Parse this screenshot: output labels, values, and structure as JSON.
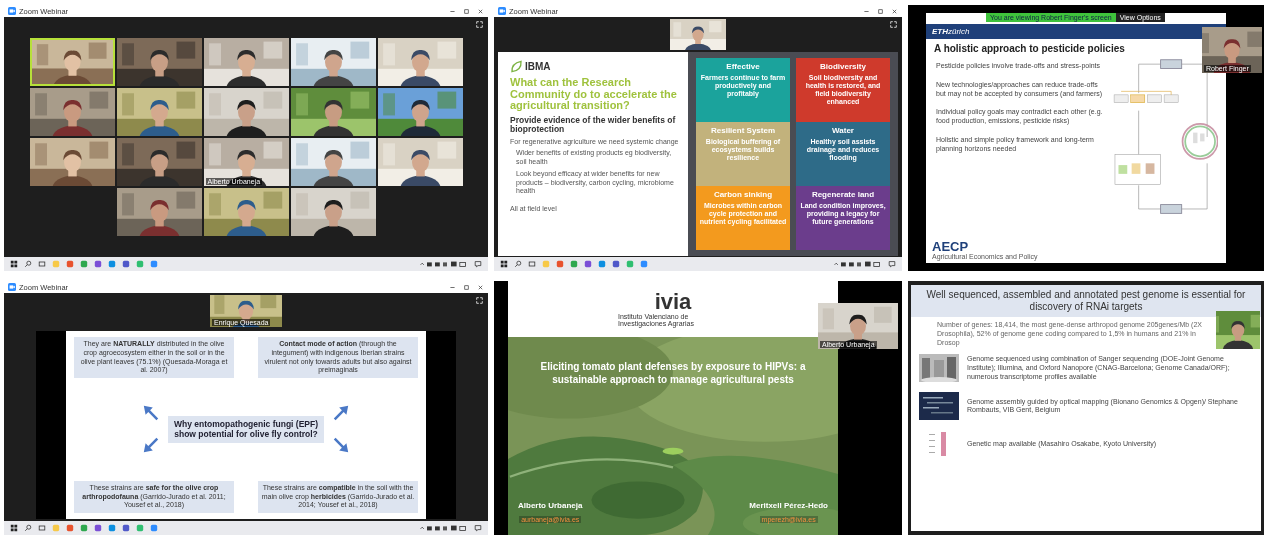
{
  "panels": [
    {
      "kind": "gallery",
      "window_title": "Zoom Webinar",
      "taskbar": true,
      "tiles": [
        {
          "active": true
        },
        {
          "active": false
        },
        {
          "active": false
        },
        {
          "active": false
        },
        {
          "active": false
        },
        {
          "active": false
        },
        {
          "active": false
        },
        {
          "active": false
        },
        {
          "active": false
        },
        {
          "active": false
        },
        {
          "active": false
        },
        {
          "active": false
        },
        {
          "active": false,
          "name": "Alberto Urbaneja"
        },
        {
          "active": false
        },
        {
          "active": false
        },
        {
          "active": false
        },
        {
          "active": false
        },
        {
          "active": false
        }
      ]
    },
    {
      "kind": "cards",
      "window_title": "Zoom Webinar",
      "taskbar": true,
      "speaker": {
        "kind": "picture"
      },
      "logo": "IBMA",
      "title": "What can the Research Community do to accelerate the agricultural transition?",
      "subtitle": "Provide evidence of the wider benefits of bioprotection",
      "intro": "For regenerative agriculture we need systemic change",
      "bullets": [
        "Wider benefits of existing products eg biodiversity, soil health",
        "Look beyond efficacy at wider benefits for new products – biodiversity, carbon cycling, microbiome health"
      ],
      "footer": "All at field level",
      "cards": [
        {
          "title": "Effective",
          "text": "Farmers continue to farm productively and profitably",
          "color": "#1ba39c"
        },
        {
          "title": "Biodiversity",
          "text": "Soil biodiversity and health is restored, and field biodiversity enhanced",
          "color": "#cf3a2c"
        },
        {
          "title": "Resilient System",
          "text": "Biological buffering of ecosystems builds resilience",
          "color": "#c2b27c"
        },
        {
          "title": "Water",
          "text": "Healthy soil assists drainage and reduces flooding",
          "color": "#2e6b88"
        },
        {
          "title": "Carbon sinking",
          "text": "Microbes within carbon cycle protection and nutrient cycling facilitated",
          "color": "#f39a1e"
        },
        {
          "title": "Regenerate land",
          "text": "Land condition improves, providing a legacy for future generations",
          "color": "#6b3d8c"
        }
      ]
    },
    {
      "kind": "diagram",
      "banner": "You are viewing Robert Finger's screen",
      "view_button": "View Options",
      "logo": "**ETH**zürich",
      "speaker": {
        "kind": "picture",
        "name": "Robert Finger"
      },
      "title": "A holistic approach to pesticide policies",
      "bullets": [
        "Pesticide policies involve trade-offs and stress-points",
        "New technologies/approaches can reduce trade-offs but may not be accepted by consumers (and farmers)",
        "Individual policy goals may contradict each other (e.g. food production, emissions, pesticide risks)",
        "Holistic and simple policy framework and long-term planning horizons needed"
      ],
      "footer_logo": "AECP",
      "footer_caption": "Agricultural Economics and Policy"
    },
    {
      "kind": "arrows",
      "window_title": "Zoom Webinar",
      "taskbar": true,
      "speaker": {
        "kind": "picture",
        "name": "Enrique Quesada"
      },
      "center": "Why entomopathogenic fungi (EPF) show potential for olive fly control?",
      "boxes": [
        "They are **NATURALLY** distributed in the olive crop agroecosystem either in the soil or in the olive plant leaves (75.1%) (Quesada-Moraga et al. 2007)",
        "**Contact mode of action** (through the integument) with indigenous Iberian strains virulent not only towards adults but also against preimaginals",
        "These strains are **safe for the olive crop arthropodofauna** (Garrido-Jurado et al. 2011; Yousef et al., 2018)",
        "These strains are **compatible** in the soil with the main olive crop **herbicides** (Garrido-Jurado et al. 2014; Yousef et al., 2018)"
      ]
    },
    {
      "kind": "cover",
      "speaker": {
        "kind": "picture",
        "name": "Alberto Urbaneja"
      },
      "logo": "ivia",
      "institute": "Instituto Valenciano de Investigaciones Agrarias",
      "title": "Eliciting tomato plant defenses by exposure to HIPVs: a sustainable approach to manage agricultural pests",
      "authors": [
        {
          "name": "Alberto Urbaneja",
          "email": "aurbaneja@ivia.es"
        },
        {
          "name": "Meritxell Pérez-Hedo",
          "email": "mperezh@ivia.es"
        }
      ]
    },
    {
      "kind": "genome",
      "speaker": {
        "kind": "picture"
      },
      "title": "Well sequenced, assembled and annotated pest genome is essential for discovery of RNAi targets",
      "note": "Number of genes: 18,414, the most gene-dense arthropod genome 205genes/Mb (2X Drosophila), 52% of genome gene coding compared to 1,5% in humans and 21% in Drosop",
      "rows": [
        {
          "text": "Genome sequenced using combination of Sanger sequencing (DOE-Joint Genome Institute); Illumina, and Oxford Nanopore (CNAG-Barcelona; Genome Canada/ORF); numerous transcriptome profiles available"
        },
        {
          "text": "Genome assembly guided by optical mapping (Bionano Genomics & Opgen)/ Stephane Rombauts, VIB Gent, Belgium"
        },
        {
          "text": "Genetic map available (Masahiro Osakabe, Kyoto University)"
        }
      ]
    }
  ]
}
